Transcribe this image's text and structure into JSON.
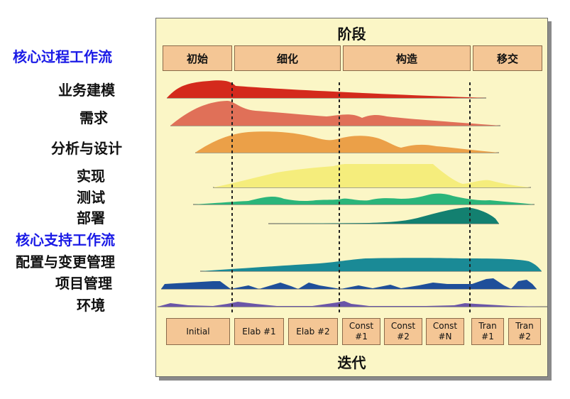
{
  "labels": {
    "core_process": "核心过程工作流",
    "business_modeling": "业务建模",
    "requirements": "需求",
    "analysis_design": "分析与设计",
    "implementation": "实现",
    "test": "测试",
    "deployment": "部署",
    "core_support": "核心支持工作流",
    "config_change": "配置与变更管理",
    "project_mgmt": "项目管理",
    "environment": "环境"
  },
  "header": {
    "title": "阶段",
    "phases": [
      "初始",
      "细化",
      "构造",
      "移交"
    ]
  },
  "footer": {
    "title": "迭代",
    "iterations": [
      {
        "l1": "Initial",
        "l2": ""
      },
      {
        "l1": "Elab #1",
        "l2": ""
      },
      {
        "l1": "Elab #2",
        "l2": ""
      },
      {
        "l1": "Const",
        "l2": "#1"
      },
      {
        "l1": "Const",
        "l2": "#2"
      },
      {
        "l1": "Const",
        "l2": "#N"
      },
      {
        "l1": "Tran",
        "l2": "#1"
      },
      {
        "l1": "Tran",
        "l2": "#2"
      }
    ]
  },
  "colors": {
    "panel": "#fbf6c6",
    "box": "#f4c695",
    "core_label": "#1a1ae6",
    "business_modeling": "#d42a1c",
    "requirements": "#e07058",
    "analysis_design": "#eba048",
    "implementation": "#f5ed7c",
    "test": "#2bb57a",
    "deployment": "#138070",
    "config_change": "#1a8a96",
    "project_mgmt": "#1f4f9a",
    "environment": "#6a55a8"
  }
}
